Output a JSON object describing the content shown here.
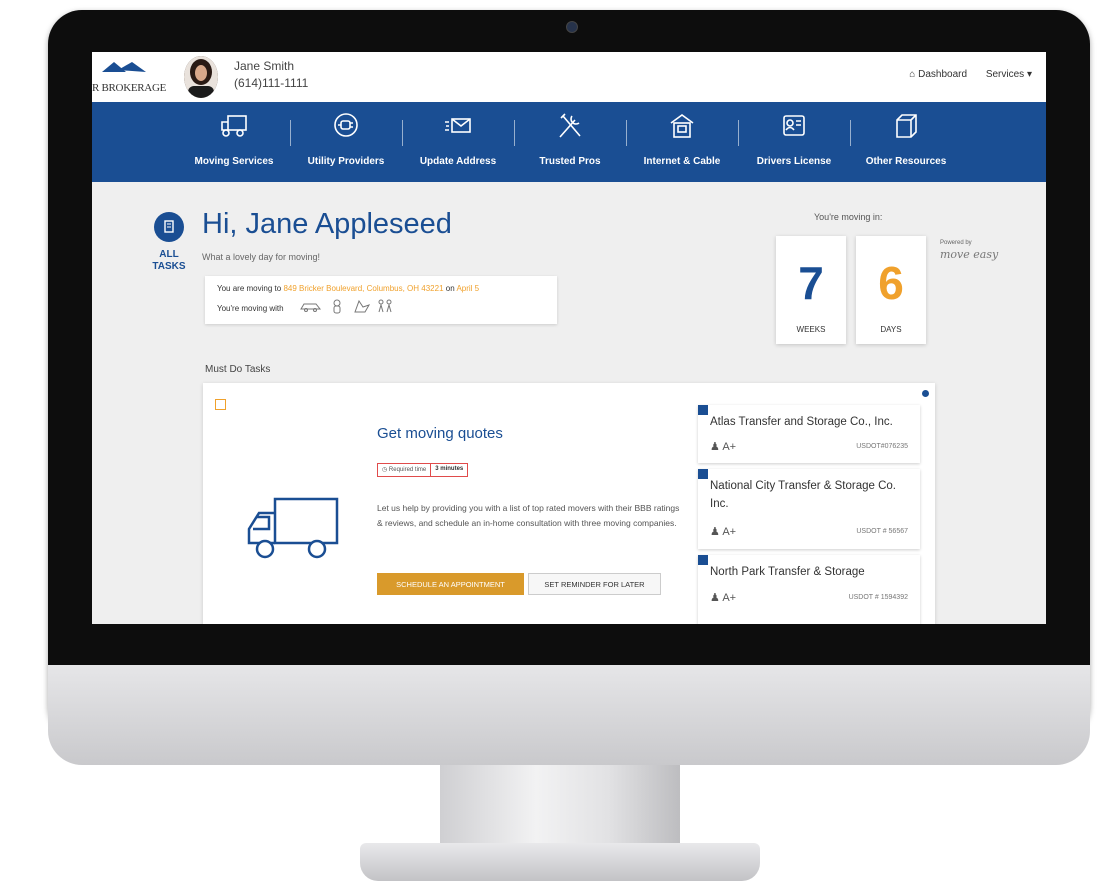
{
  "header": {
    "brand": "R BROKERAGE",
    "agent_name": "Jane Smith",
    "agent_phone": "(614)111-1111",
    "links": [
      "Dashboard",
      "Services"
    ]
  },
  "nav": {
    "items": [
      {
        "label": "Moving Services",
        "icon": "truck-icon"
      },
      {
        "label": "Utility Providers",
        "icon": "plug-icon"
      },
      {
        "label": "Update Address",
        "icon": "envelope-icon"
      },
      {
        "label": "Trusted Pros",
        "icon": "tools-icon"
      },
      {
        "label": "Internet & Cable",
        "icon": "router-icon"
      },
      {
        "label": "Drivers License",
        "icon": "id-card-icon"
      },
      {
        "label": "Other Resources",
        "icon": "box-icon"
      }
    ]
  },
  "dashboard": {
    "all_tasks_label_1": "ALL",
    "all_tasks_label_2": "TASKS",
    "greeting": "Hi, Jane Appleseed",
    "subgreeting": "What a lovely day for moving!",
    "move_prefix": "You are moving to",
    "move_address": "849 Bricker Boulevard, Columbus, OH 43221",
    "move_on": "on",
    "move_date": "April 5",
    "moving_with": "You're moving with",
    "moving_in_label": "You're moving in:",
    "weeks_value": "7",
    "weeks_label": "WEEKS",
    "days_value": "6",
    "days_label": "DAYS",
    "powered_by": "Powered by",
    "powered_brand": "move easy",
    "weeks_color": "#1a4e93",
    "days_color": "#f0a12c"
  },
  "tasks": {
    "section_title": "Must Do Tasks",
    "task_title": "Get moving quotes",
    "required_label": "Required time",
    "required_value": "3 minutes",
    "description": "Let us help by providing you with a list of top rated movers with their BBB ratings & reviews, and schedule an in-home consultation with three moving companies.",
    "schedule_button": "SCHEDULE AN APPOINTMENT",
    "reminder_button": "SET REMINDER FOR LATER"
  },
  "movers": [
    {
      "name": "Atlas Transfer and Storage Co., Inc.",
      "rating": "A+",
      "usdot": "USDOT#076235"
    },
    {
      "name": "National City Transfer & Storage Co. Inc.",
      "rating": "A+",
      "usdot": "USDOT # 56567"
    },
    {
      "name": "North Park Transfer & Storage",
      "rating": "A+",
      "usdot": "USDOT # 1594392"
    }
  ]
}
